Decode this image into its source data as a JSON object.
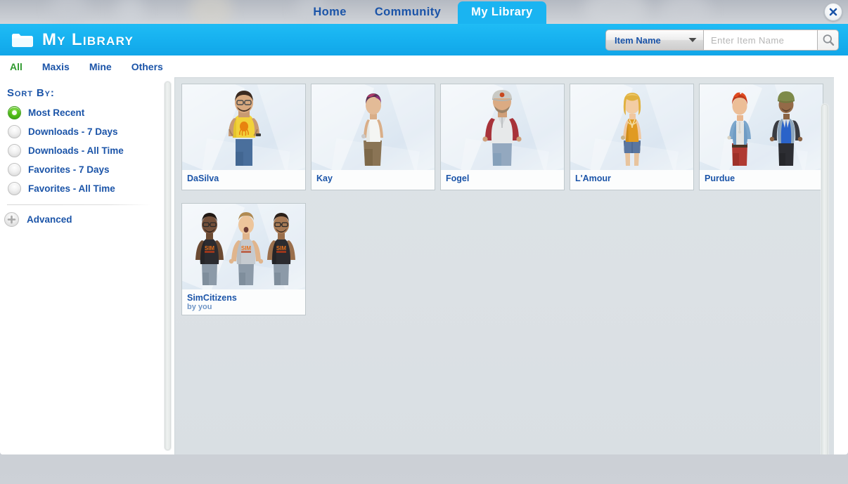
{
  "window": {
    "close_icon": "close-icon"
  },
  "nav": {
    "tabs": [
      {
        "label": "Home",
        "active": false
      },
      {
        "label": "Community",
        "active": false
      },
      {
        "label": "My Library",
        "active": true
      }
    ]
  },
  "header": {
    "title": "My Library",
    "folder_icon": "folder-icon",
    "accent_color": "#16b0ef"
  },
  "search": {
    "selected_category": "Item Name",
    "placeholder": "Enter Item Name",
    "value": "",
    "dropdown_icon": "chevron-down-icon",
    "search_icon": "search-icon"
  },
  "filter_tabs": [
    {
      "label": "All",
      "active": true
    },
    {
      "label": "Maxis",
      "active": false
    },
    {
      "label": "Mine",
      "active": false
    },
    {
      "label": "Others",
      "active": false
    }
  ],
  "sidebar": {
    "sort_by_title": "Sort By:",
    "sort_options": [
      {
        "label": "Most Recent",
        "selected": true
      },
      {
        "label": "Downloads - 7 Days",
        "selected": false
      },
      {
        "label": "Downloads - All Time",
        "selected": false
      },
      {
        "label": "Favorites - 7 Days",
        "selected": false
      },
      {
        "label": "Favorites - All Time",
        "selected": false
      }
    ],
    "advanced": {
      "label": "Advanced",
      "icon": "plus-circle-icon"
    }
  },
  "items": [
    {
      "title": "DaSilva",
      "subtitle": ""
    },
    {
      "title": "Kay",
      "subtitle": ""
    },
    {
      "title": "Fogel",
      "subtitle": ""
    },
    {
      "title": "L'Amour",
      "subtitle": ""
    },
    {
      "title": "Purdue",
      "subtitle": ""
    },
    {
      "title": "SimCitizens",
      "subtitle": "by you"
    }
  ]
}
